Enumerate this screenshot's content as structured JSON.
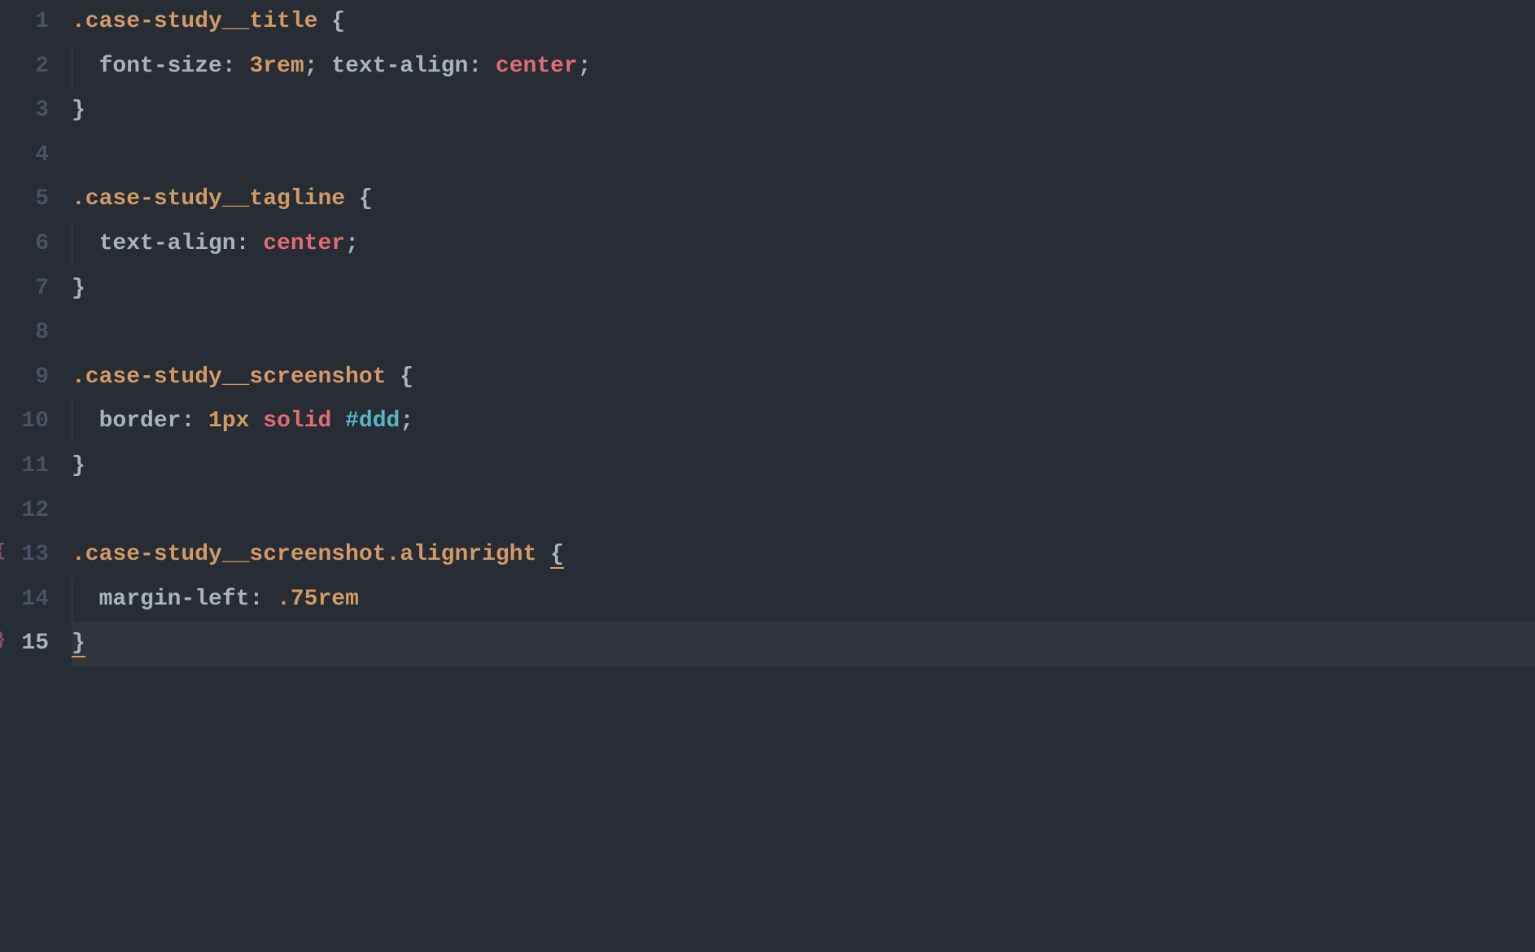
{
  "lines": [
    {
      "num": "1",
      "tokens": [
        {
          "t": ".case-study__title ",
          "c": "tok-selector"
        },
        {
          "t": "{",
          "c": "tok-brace"
        }
      ]
    },
    {
      "num": "2",
      "indent": true,
      "tokens": [
        {
          "t": "font-size",
          "c": "tok-prop"
        },
        {
          "t": ": ",
          "c": "tok-punct"
        },
        {
          "t": "3rem",
          "c": "tok-num"
        },
        {
          "t": "; ",
          "c": "tok-punct"
        },
        {
          "t": "text-align",
          "c": "tok-prop"
        },
        {
          "t": ": ",
          "c": "tok-punct"
        },
        {
          "t": "center",
          "c": "tok-val"
        },
        {
          "t": ";",
          "c": "tok-punct"
        }
      ]
    },
    {
      "num": "3",
      "tokens": [
        {
          "t": "}",
          "c": "tok-brace"
        }
      ]
    },
    {
      "num": "4",
      "tokens": []
    },
    {
      "num": "5",
      "tokens": [
        {
          "t": ".case-study__tagline ",
          "c": "tok-selector"
        },
        {
          "t": "{",
          "c": "tok-brace"
        }
      ]
    },
    {
      "num": "6",
      "indent": true,
      "tokens": [
        {
          "t": "text-align",
          "c": "tok-prop"
        },
        {
          "t": ": ",
          "c": "tok-punct"
        },
        {
          "t": "center",
          "c": "tok-val"
        },
        {
          "t": ";",
          "c": "tok-punct"
        }
      ]
    },
    {
      "num": "7",
      "tokens": [
        {
          "t": "}",
          "c": "tok-brace"
        }
      ]
    },
    {
      "num": "8",
      "tokens": []
    },
    {
      "num": "9",
      "tokens": [
        {
          "t": ".case-study__screenshot ",
          "c": "tok-selector"
        },
        {
          "t": "{",
          "c": "tok-brace"
        }
      ]
    },
    {
      "num": "10",
      "indent": true,
      "tokens": [
        {
          "t": "border",
          "c": "tok-prop"
        },
        {
          "t": ": ",
          "c": "tok-punct"
        },
        {
          "t": "1px",
          "c": "tok-num"
        },
        {
          "t": " ",
          "c": "tok-punct"
        },
        {
          "t": "solid",
          "c": "tok-val"
        },
        {
          "t": " ",
          "c": "tok-punct"
        },
        {
          "t": "#ddd",
          "c": "tok-val-ident"
        },
        {
          "t": ";",
          "c": "tok-punct"
        }
      ]
    },
    {
      "num": "11",
      "tokens": [
        {
          "t": "}",
          "c": "tok-brace"
        }
      ]
    },
    {
      "num": "12",
      "tokens": []
    },
    {
      "num": "13",
      "marker": "{",
      "tokens": [
        {
          "t": ".case-study__screenshot.alignright ",
          "c": "tok-selector"
        },
        {
          "t": "{",
          "c": "tok-brace",
          "underline": true
        }
      ]
    },
    {
      "num": "14",
      "indent": true,
      "tokens": [
        {
          "t": "margin-left",
          "c": "tok-prop"
        },
        {
          "t": ": ",
          "c": "tok-punct"
        },
        {
          "t": ".75rem",
          "c": "tok-num"
        }
      ]
    },
    {
      "num": "15",
      "marker": "}",
      "active": true,
      "tokens": [
        {
          "t": "}",
          "c": "tok-brace",
          "underline": true
        }
      ]
    }
  ]
}
